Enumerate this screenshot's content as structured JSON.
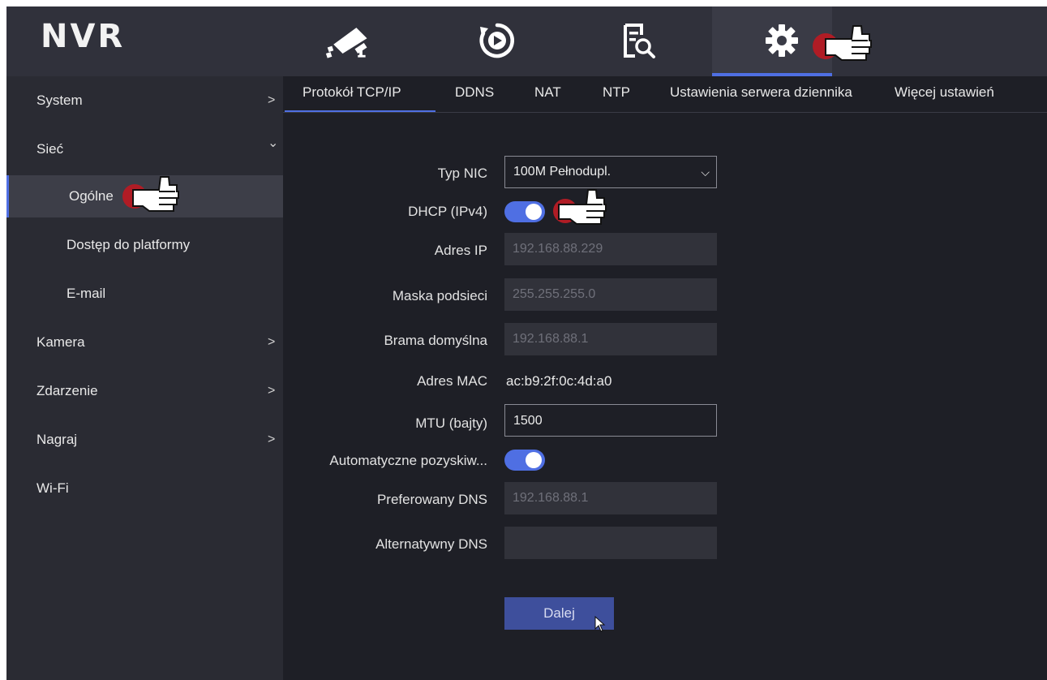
{
  "app": {
    "logo": "NVR"
  },
  "topnav": [
    {
      "name": "live-view-icon"
    },
    {
      "name": "playback-icon"
    },
    {
      "name": "search-icon"
    },
    {
      "name": "gear-icon"
    }
  ],
  "sidebar": {
    "items": [
      {
        "label": "System",
        "chevron": ">"
      },
      {
        "label": "Sieć",
        "chevron": "⌄"
      },
      {
        "label": "Ogólne"
      },
      {
        "label": "Dostęp do platformy"
      },
      {
        "label": "E-mail"
      },
      {
        "label": "Kamera",
        "chevron": ">"
      },
      {
        "label": "Zdarzenie",
        "chevron": ">"
      },
      {
        "label": "Nagraj",
        "chevron": ">"
      },
      {
        "label": "Wi-Fi"
      }
    ]
  },
  "tabs": [
    {
      "label": "Protokół TCP/IP"
    },
    {
      "label": "DDNS"
    },
    {
      "label": "NAT"
    },
    {
      "label": "NTP"
    },
    {
      "label": "Ustawienia serwera dziennika"
    },
    {
      "label": "Więcej ustawień"
    }
  ],
  "form": {
    "nic_type": {
      "label": "Typ NIC",
      "value": "100M Pełnodupl."
    },
    "dhcp": {
      "label": "DHCP (IPv4)",
      "on": true
    },
    "ip": {
      "label": "Adres IP",
      "value": "192.168.88.229"
    },
    "mask": {
      "label": "Maska podsieci",
      "value": "255.255.255.0"
    },
    "gateway": {
      "label": "Brama domyślna",
      "value": "192.168.88.1"
    },
    "mac": {
      "label": "Adres MAC",
      "value": "ac:b9:2f:0c:4d:a0"
    },
    "mtu": {
      "label": "MTU (bajty)",
      "value": "1500"
    },
    "auto_dns": {
      "label": "Automatyczne pozyskiw...",
      "on": true
    },
    "dns1": {
      "label": "Preferowany DNS",
      "value": "192.168.88.1"
    },
    "dns2": {
      "label": "Alternatywny DNS",
      "value": ""
    },
    "next_label": "Dalej"
  },
  "colors": {
    "accent": "#4f6fe3",
    "button": "#3e4f9c",
    "annotation_red": "#b01c25"
  }
}
